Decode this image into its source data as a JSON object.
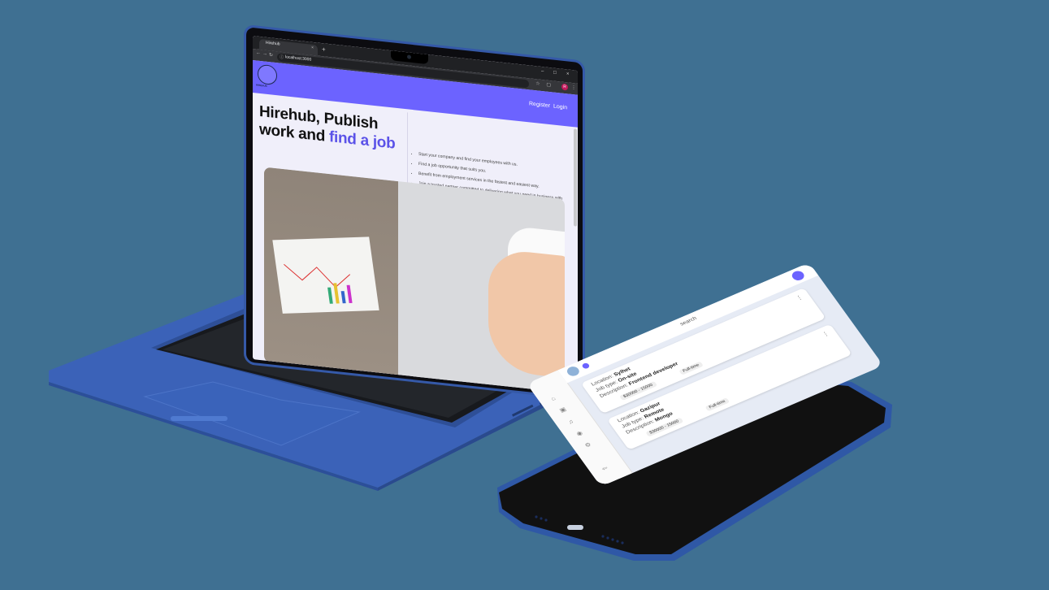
{
  "browser": {
    "tab_title": "Hirehub",
    "tab_close": "×",
    "new_tab": "+",
    "url": "localhost:3000",
    "window_controls": {
      "minimize": "–",
      "maximize": "□",
      "close": "×"
    },
    "profile_initial": "R"
  },
  "site": {
    "logo_text": "HIREHUB",
    "nav": {
      "register": "Register",
      "login": "Login"
    },
    "hero_title_line1": "Hirehub, Publish",
    "hero_title_line2a": "work and ",
    "hero_title_line2b": "find a job",
    "bullets": [
      "Start your company and find your employees with us.",
      "Find a job opportunity that suits you.",
      "Benefit from employment services in the fastest and easiest way.",
      "Join a trusted partner committed to delivering what you need in business with precision and flair."
    ]
  },
  "phone": {
    "header_text": "search",
    "cards": [
      {
        "location_label": "Location:",
        "location": "Sylhet",
        "type_label": "Job type:",
        "type": "On-site",
        "desc_label": "Description:",
        "desc": "Frontend developer",
        "salary": "$30000 - 15000",
        "tag": "Full-time"
      },
      {
        "location_label": "Location:",
        "location": "Gazipur",
        "type_label": "Job type:",
        "type": "Remote",
        "desc_label": "Description:",
        "desc": "Mongo",
        "salary": "$30000 - 15000",
        "tag": "Full-time"
      }
    ]
  },
  "colors": {
    "background": "#3f7092",
    "device_blue": "#3559a8",
    "brand_purple": "#6c63ff"
  }
}
